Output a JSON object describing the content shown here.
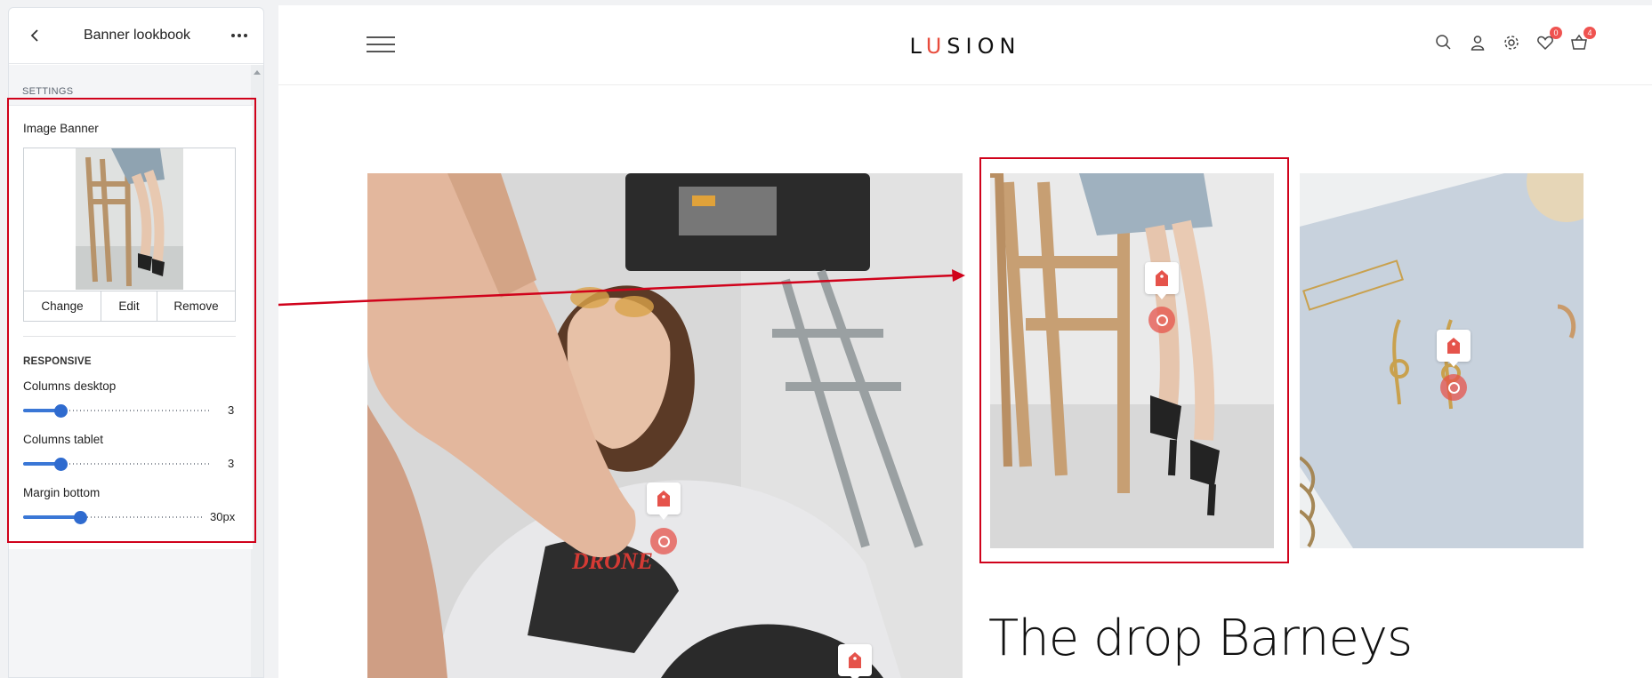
{
  "panel": {
    "title": "Banner lookbook",
    "section_label": "SETTINGS",
    "image_banner": {
      "label": "Image Banner",
      "actions": [
        "Change",
        "Edit",
        "Remove"
      ]
    },
    "responsive": {
      "heading": "RESPONSIVE",
      "sliders": [
        {
          "label": "Columns desktop",
          "value": "3",
          "level": 0.2
        },
        {
          "label": "Columns tablet",
          "value": "3",
          "level": 0.2
        },
        {
          "label": "Margin bottom",
          "value": "30px",
          "level": 0.32
        }
      ]
    },
    "icons": {
      "back": "chevron-left-icon",
      "more": "ellipsis-icon"
    }
  },
  "preview": {
    "logo_first": "L",
    "logo_accent": "U",
    "logo_rest": "SION",
    "headline": "The drop Barneys",
    "header_icons": [
      "search-icon",
      "user-icon",
      "gear-icon",
      "heart-icon",
      "cart-icon"
    ],
    "wishlist_count": "0",
    "cart_count": "4",
    "accent_color": "#e84c3d",
    "annotation_color": "#d0021b"
  }
}
